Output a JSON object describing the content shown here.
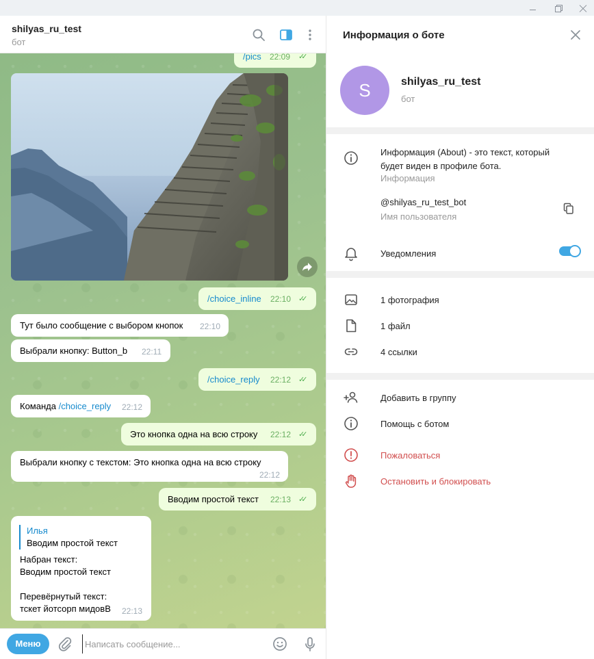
{
  "chat": {
    "title": "shilyas_ru_test",
    "subtitle": "бот",
    "icons": {
      "search": "search-icon",
      "panel": "sidebar-toggle-icon",
      "more": "more-vertical-icon"
    },
    "messages": [
      {
        "text": "/pics",
        "time": "22:09",
        "direction": "out",
        "is_command": true
      },
      {
        "type": "photo",
        "description": "stone stairs mountain lake"
      },
      {
        "text": "/choice_inline",
        "time": "22:10",
        "direction": "out",
        "is_command": true
      },
      {
        "text": "Тут было сообщение с выбором кнопок",
        "time": "22:10",
        "direction": "in"
      },
      {
        "text": "Выбрали кнопку: Button_b",
        "time": "22:11",
        "direction": "in"
      },
      {
        "text": "/choice_reply",
        "time": "22:12",
        "direction": "out",
        "is_command": true
      },
      {
        "prefix": "Команда ",
        "link": "/choice_reply",
        "time": "22:12",
        "direction": "in"
      },
      {
        "text": "Это кнопка одна на всю строку",
        "time": "22:12",
        "direction": "out"
      },
      {
        "text": "Выбрали кнопку с текстом: Это кнопка одна на всю строку",
        "time": "22:12",
        "direction": "in"
      },
      {
        "text": "Вводим простой текст",
        "time": "22:13",
        "direction": "out"
      },
      {
        "direction": "in",
        "reply_author": "Илья",
        "reply_text": "Вводим простой текст",
        "lines": [
          "Набран текст:",
          "Вводим простой текст",
          "",
          "Перевёрнутый текст:",
          "тскет йотсорп мидовВ"
        ],
        "time": "22:13"
      }
    ],
    "composer": {
      "menu_label": "Меню",
      "placeholder": "Написать сообщение..."
    }
  },
  "info": {
    "title": "Информация о боте",
    "avatar_letter": "S",
    "avatar_color": "#b197e6",
    "name": "shilyas_ru_test",
    "type": "бот",
    "about_text_line1": "Информация (About) - это текст, который",
    "about_text_line2": "будет виден в профиле бота.",
    "about_label": "Информация",
    "username": "@shilyas_ru_test_bot",
    "username_label": "Имя пользователя",
    "notifications_label": "Уведомления",
    "notifications_on": true,
    "media": [
      "1 фотография",
      "1 файл",
      "4 ссылки"
    ],
    "actions": [
      "Добавить в группу",
      "Помощь с ботом"
    ],
    "danger_actions": [
      "Пожаловаться",
      "Остановить и блокировать"
    ]
  },
  "colors": {
    "accent": "#40a7e3",
    "link": "#168acd",
    "outgoing_bubble": "#effdde",
    "danger": "#d14e4e"
  }
}
